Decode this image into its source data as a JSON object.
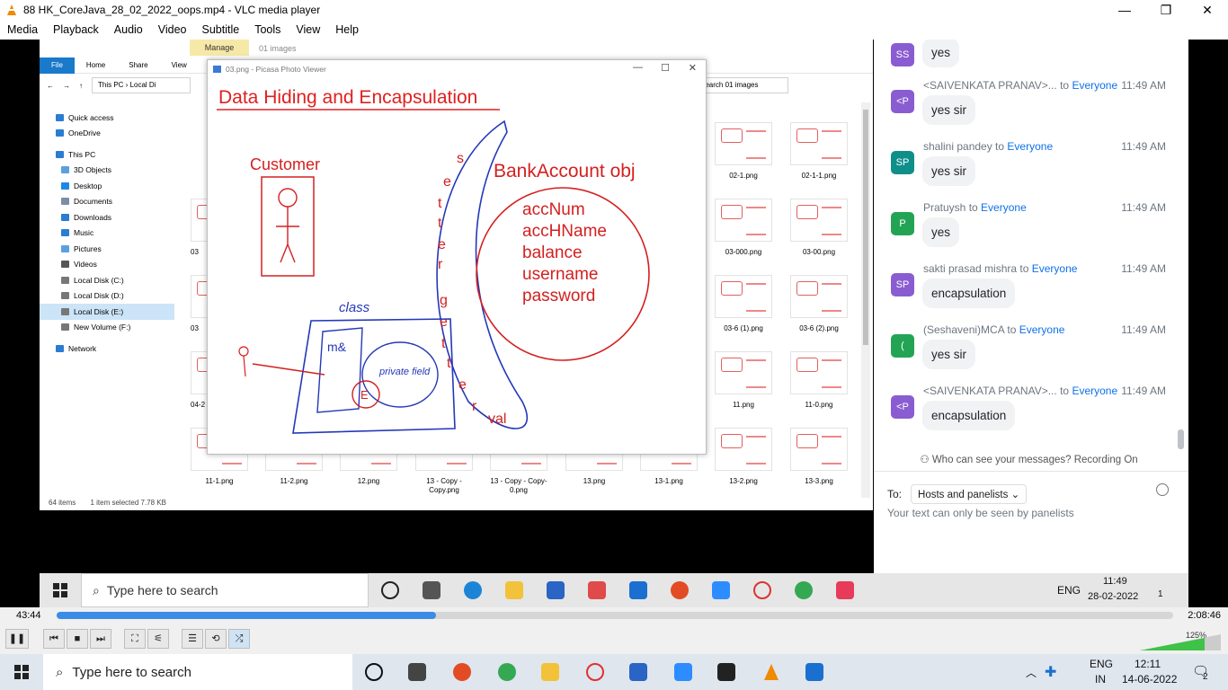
{
  "vlc": {
    "window_title": "88 HK_CoreJava_28_02_2022_oops.mp4 - VLC media player",
    "menu": [
      "Media",
      "Playback",
      "Audio",
      "Video",
      "Subtitle",
      "Tools",
      "View",
      "Help"
    ],
    "time_current": "43:44",
    "time_total": "2:08:46",
    "progress": 0.34,
    "volume": "125%"
  },
  "explorer": {
    "manage_label": "Manage",
    "title": "01 images",
    "tabs": [
      "File",
      "Home",
      "Share",
      "View",
      "Pic"
    ],
    "path": [
      "This PC",
      "Local Di"
    ],
    "search_placeholder": "Search 01 images",
    "nav": [
      {
        "label": "Quick access",
        "color": "#2b7cd3"
      },
      {
        "label": "OneDrive",
        "color": "#2b7cd3"
      },
      {
        "label": "This PC",
        "color": "#2b7cd3"
      },
      {
        "label": "3D Objects",
        "color": "#5aa0e0"
      },
      {
        "label": "Desktop",
        "color": "#1e88e5"
      },
      {
        "label": "Documents",
        "color": "#7a8ea8"
      },
      {
        "label": "Downloads",
        "color": "#2b7cd3"
      },
      {
        "label": "Music",
        "color": "#2b7cd3"
      },
      {
        "label": "Pictures",
        "color": "#5aa0e0"
      },
      {
        "label": "Videos",
        "color": "#555"
      },
      {
        "label": "Local Disk (C:)",
        "color": "#777"
      },
      {
        "label": "Local Disk (D:)",
        "color": "#777"
      },
      {
        "label": "Local Disk (E:)",
        "color": "#777"
      },
      {
        "label": "New Volume (F:)",
        "color": "#777"
      },
      {
        "label": "Network",
        "color": "#2b7cd3"
      }
    ],
    "selected_nav": "Local Disk (E:)",
    "status": [
      "64 items",
      "1 item selected  7.78 KB"
    ],
    "thumbs_right": [
      "02-1.png",
      "02-1-1.png",
      "03-000.png",
      "03-00.png",
      "03-6 (1).png",
      "03-6 (2).png",
      "11.png",
      "11-0.png"
    ],
    "thumbs_bottom": [
      "11-1.png",
      "11-2.png",
      "12.png",
      "13 - Copy - Copy.png",
      "13 - Copy - Copy-0.png",
      "13.png",
      "13-1.png",
      "13-2.png",
      "13-3.png"
    ],
    "left_partial": [
      "03",
      "03",
      "04-2"
    ]
  },
  "picasa": {
    "title": "03.png - Picasa Photo Viewer",
    "slide": {
      "heading": "Data Hiding and Encapsulation",
      "customer": "Customer",
      "bank_obj": "BankAccount obj",
      "fields": [
        "accNum",
        "accHName",
        "balance",
        "username",
        "password"
      ],
      "setter_letters": [
        "s",
        "e",
        "t",
        "t",
        "e",
        "r"
      ],
      "getter_letters": [
        "g",
        "e",
        "t",
        "t",
        "e",
        "r"
      ],
      "val_text": "val",
      "class_text": "class",
      "ms_text": "m&",
      "private_text": "private field",
      "e_text": "E"
    }
  },
  "chat": {
    "messages": [
      {
        "initials": "SS",
        "color": "#8a5cd1",
        "sender": "",
        "to": "",
        "time": "",
        "text": "yes"
      },
      {
        "initials": "<P",
        "color": "#8a5cd1",
        "sender": "<SAIVENKATA PRANAV>...",
        "to": "Everyone",
        "time": "11:49 AM",
        "text": "yes sir"
      },
      {
        "initials": "SP",
        "color": "#0e8f8a",
        "sender": "shalini pandey to",
        "to": "Everyone",
        "time": "11:49 AM",
        "text": "yes sir"
      },
      {
        "initials": "P",
        "color": "#23a455",
        "sender": "Pratuysh to",
        "to": "Everyone",
        "time": "11:49 AM",
        "text": "yes"
      },
      {
        "initials": "SP",
        "color": "#8a5cd1",
        "sender": "sakti prasad mishra to",
        "to": "Everyone",
        "time": "11:49 AM",
        "text": "encapsulation"
      },
      {
        "initials": "(",
        "color": "#23a455",
        "sender": "(Seshaveni)MCA to",
        "to": "Everyone",
        "time": "11:49 AM",
        "text": "yes sir"
      },
      {
        "initials": "<P",
        "color": "#8a5cd1",
        "sender": "<SAIVENKATA PRANAV>...",
        "to": "Everyone",
        "time": "11:49 AM",
        "text": "encapsulation"
      }
    ],
    "to_word": "to",
    "notice": "Who can see your messages? Recording On",
    "to_label": "To:",
    "recipient": "Hosts and panelists",
    "input_placeholder": "Your text can only be seen by panelists"
  },
  "video_taskbar": {
    "search": "Type here to search",
    "lang": "ENG",
    "time": "11:49",
    "date": "28-02-2022",
    "notif": "1"
  },
  "taskbar": {
    "search": "Type here to search",
    "lang": "ENG",
    "region": "IN",
    "time": "12:11",
    "date": "14-06-2022",
    "notif": "2"
  }
}
